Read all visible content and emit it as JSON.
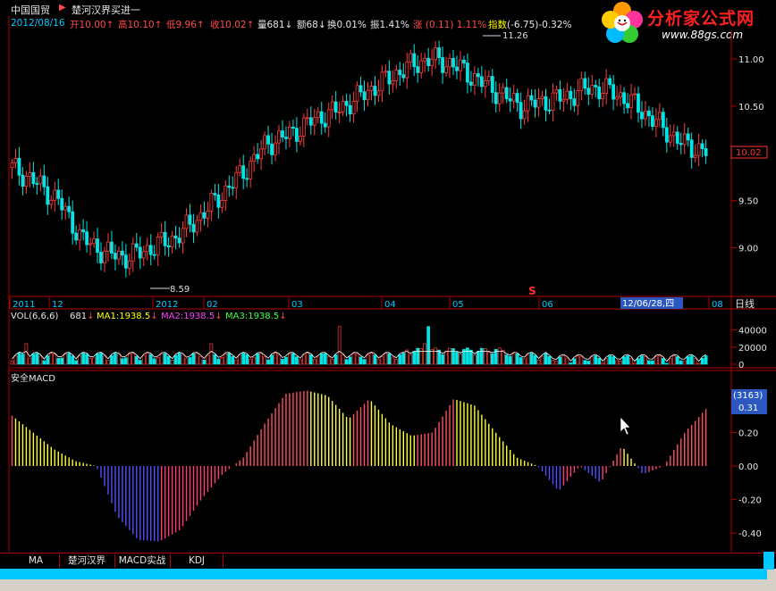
{
  "header": {
    "stock_name": "中国国贸",
    "formula_name": "楚河汉界买进一",
    "date": "2012/08/16",
    "open_label": "开",
    "open": "10.00",
    "high_label": "高",
    "high": "10.10",
    "low_label": "低",
    "low": "9.96",
    "close_label": "收",
    "close": "10.02",
    "volume_label": "量",
    "volume": "681",
    "amount_label": "额",
    "amount": "68",
    "turnover_label": "换",
    "turnover": "0.01%",
    "amplitude_label": "振",
    "amplitude": "1.41%",
    "change_label": "涨",
    "change": "(0.11)",
    "change_pct": "1.11%",
    "index_label": "指数",
    "index_value": "(-6.75)",
    "index_pct": "-0.32%"
  },
  "logo": {
    "title": "分析家公式网",
    "url": "www.88gs.com"
  },
  "price_panel": {
    "y_ticks": [
      "11.00",
      "10.50",
      "10.00",
      "9.50",
      "9.00"
    ],
    "current_price": "10.02",
    "max_annotation": "11.26",
    "min_annotation": "8.59",
    "signal_mark": "S"
  },
  "time_axis": {
    "labels": [
      "2011",
      "12",
      "2012",
      "02",
      "03",
      "04",
      "05",
      "06",
      "08"
    ],
    "cursor_date": "12/06/28,四",
    "period_label": "日线"
  },
  "volume_panel": {
    "title": "VOL(6,6,6)",
    "value": "681",
    "ma1_label": "MA1:",
    "ma1": "1938.5",
    "ma2_label": "MA2:",
    "ma2": "1938.5",
    "ma3_label": "MA3:",
    "ma3": "1938.5",
    "y_ticks": [
      "40000",
      "20000",
      "0"
    ]
  },
  "macd_panel": {
    "title": "安全MACD",
    "cursor_box_top": "(3163)",
    "cursor_box_value": "0.31",
    "y_ticks": [
      "0.20",
      "0.00",
      "-0.20",
      "-0.40"
    ]
  },
  "tabs": [
    "MA",
    "楚河汉界",
    "MACD实战",
    "KDJ"
  ],
  "colors": {
    "up": "#ff3c3c",
    "down": "#00e6e6",
    "axis": "#b00000",
    "ma_line": "#ffffff",
    "macd_pos_red": "#ff5064",
    "macd_pos_yellow": "#ffff40",
    "macd_neg_blue": "#5050ff",
    "macd_neg_pink": "#ff3c78"
  },
  "chart_data": [
    {
      "type": "candlestick",
      "title": "中国国贸",
      "ylabel": "",
      "ylim": [
        8.45,
        11.35
      ],
      "x": [
        "2011-11",
        "2011-12",
        "2012-01",
        "2012-02",
        "2012-03",
        "2012-04",
        "2012-05",
        "2012-06",
        "2012-07",
        "2012-08"
      ],
      "close_path": [
        9.85,
        9.7,
        9.5,
        9.1,
        8.95,
        8.9,
        9.0,
        9.1,
        9.3,
        9.55,
        9.8,
        10.1,
        10.2,
        10.35,
        10.45,
        10.6,
        10.75,
        10.9,
        11.0,
        10.95,
        10.8,
        10.65,
        10.5,
        10.55,
        10.6,
        10.7,
        10.65,
        10.5,
        10.3,
        10.1,
        10.02
      ],
      "annotations": {
        "max": 11.26,
        "min": 8.59,
        "last": 10.02
      }
    },
    {
      "type": "bar",
      "title": "VOL(6,6,6)",
      "ylim": [
        0,
        50000
      ],
      "series": [
        {
          "name": "MA1",
          "values_summary": "1938.5"
        }
      ]
    },
    {
      "type": "bar",
      "title": "安全MACD",
      "ylim": [
        -0.47,
        0.47
      ],
      "macd_curve": [
        0.3,
        0.2,
        0.1,
        0.03,
        0.0,
        -0.3,
        -0.44,
        -0.45,
        -0.38,
        -0.2,
        -0.05,
        0.05,
        0.25,
        0.43,
        0.45,
        0.42,
        0.28,
        0.4,
        0.25,
        0.18,
        0.2,
        0.4,
        0.36,
        0.2,
        0.05,
        0.0,
        -0.15,
        0.0,
        -0.1,
        0.12,
        -0.05,
        0.0,
        0.2,
        0.34
      ]
    }
  ]
}
